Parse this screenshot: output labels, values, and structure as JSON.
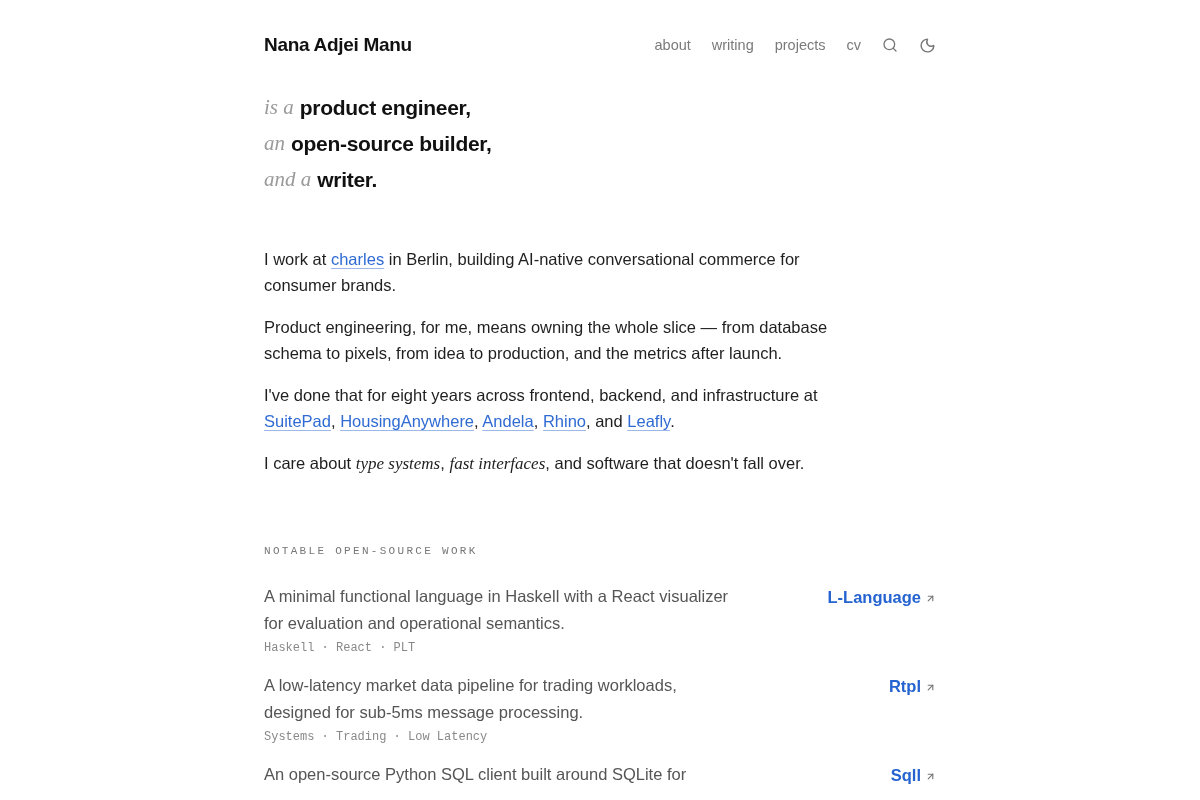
{
  "header": {
    "name": "Nana Adjei Manu",
    "nav": [
      "about",
      "writing",
      "projects",
      "cv"
    ]
  },
  "tagline": [
    {
      "lead": "is a",
      "role": "product engineer,"
    },
    {
      "lead": "an",
      "role": "open-source builder,"
    },
    {
      "lead": "and a",
      "role": "writer."
    }
  ],
  "intro": [
    {
      "parts": [
        {
          "kind": "text",
          "text": "I work at "
        },
        {
          "kind": "link",
          "text": "charles"
        },
        {
          "kind": "text",
          "text": " in Berlin, building AI-native conversational commerce for consumer brands."
        }
      ]
    },
    {
      "parts": [
        {
          "kind": "text",
          "text": "Product engineering, for me, means owning the whole slice — from database schema to pixels, from idea to production, and the metrics after launch."
        }
      ]
    },
    {
      "parts": [
        {
          "kind": "text",
          "text": "I've done that for eight years across frontend, backend, and infrastructure at "
        },
        {
          "kind": "link",
          "text": "SuitePad"
        },
        {
          "kind": "text",
          "text": ", "
        },
        {
          "kind": "link",
          "text": "HousingAnywhere"
        },
        {
          "kind": "text",
          "text": ", "
        },
        {
          "kind": "link",
          "text": "Andela"
        },
        {
          "kind": "text",
          "text": ", "
        },
        {
          "kind": "link",
          "text": "Rhino"
        },
        {
          "kind": "text",
          "text": ", and "
        },
        {
          "kind": "link",
          "text": "Leafly"
        },
        {
          "kind": "text",
          "text": "."
        }
      ]
    },
    {
      "parts": [
        {
          "kind": "text",
          "text": "I care about *type systems*, *fast interfaces*, and software that doesn't fall over."
        }
      ]
    }
  ],
  "open_source": {
    "heading": "NOTABLE OPEN-SOURCE WORK",
    "projects": [
      {
        "name": "L-Language",
        "description": "A minimal functional language in Haskell with a React visualizer for evaluation and operational semantics.",
        "tags": "Haskell · React · PLT"
      },
      {
        "name": "Rtpl",
        "description": "A low-latency market data pipeline for trading workloads, designed for sub-5ms message processing.",
        "tags": "Systems · Trading · Low Latency"
      },
      {
        "name": "Sqll",
        "description": "An open-source Python SQL client built around SQLite for"
      }
    ]
  }
}
